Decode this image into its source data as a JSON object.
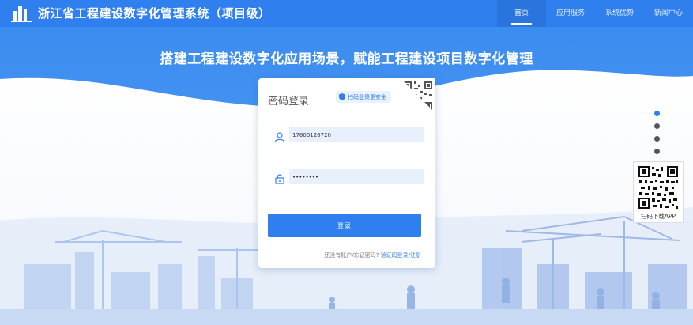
{
  "header": {
    "app_title": "浙江省工程建设数字化管理系统（项目级）",
    "nav": [
      {
        "label": "首页",
        "active": true
      },
      {
        "label": "应用服务",
        "active": false
      },
      {
        "label": "系统优势",
        "active": false
      },
      {
        "label": "新闻中心",
        "active": false
      }
    ]
  },
  "banner": {
    "slogan": "搭建工程建设数字化应用场景，赋能工程建设项目数字化管理"
  },
  "login": {
    "title": "密码登录",
    "scan_badge": "扫码登录更安全",
    "username_value": "17600126720",
    "password_value": "••••••••",
    "submit_label": "登录",
    "footer_prompt": "还没有账户/忘记密码?",
    "footer_link": "验证码登录/注册"
  },
  "carousel": {
    "dot_count": 4,
    "active_index": 0
  },
  "app_download": {
    "label": "扫码下载APP"
  },
  "colors": {
    "brand_blue": "#2f80ee",
    "header_bg": "#2f80ee",
    "banner_bg": "#3d8ff0",
    "input_bg": "#e8f0fe"
  },
  "icons": [
    "logo-icon",
    "shield-icon",
    "qr-code-icon",
    "user-icon",
    "lock-icon"
  ]
}
